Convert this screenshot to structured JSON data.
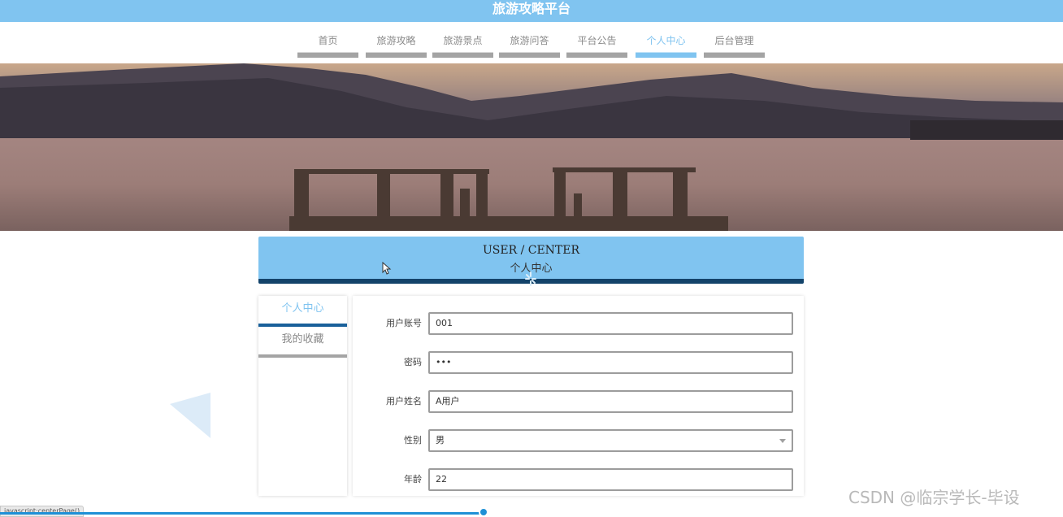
{
  "header": {
    "title": "旅游攻略平台"
  },
  "nav": {
    "items": [
      {
        "label": "首页"
      },
      {
        "label": "旅游攻略"
      },
      {
        "label": "旅游景点"
      },
      {
        "label": "旅游问答"
      },
      {
        "label": "平台公告"
      },
      {
        "label": "个人中心",
        "active": true
      },
      {
        "label": "后台管理"
      }
    ]
  },
  "center": {
    "title_en": "USER / CENTER",
    "title_cn": "个人中心"
  },
  "sidebar": {
    "items": [
      {
        "label": "个人中心",
        "active": true
      },
      {
        "label": "我的收藏"
      }
    ]
  },
  "form": {
    "fields": [
      {
        "label": "用户账号",
        "value": "001"
      },
      {
        "label": "密码",
        "value": "•••"
      },
      {
        "label": "用户姓名",
        "value": "A用户"
      },
      {
        "label": "性别",
        "value": "男",
        "type": "select"
      },
      {
        "label": "年龄",
        "value": "22"
      }
    ]
  },
  "status": {
    "link": "javascript:centerPage()"
  },
  "watermark": {
    "text": "CSDN @临宗学长-毕设"
  },
  "colors": {
    "accent": "#80c4f0",
    "dark": "#13436a",
    "inactive_bar": "#a4a4a4"
  },
  "icons": [
    "cursor-icon",
    "loading-spinner-icon",
    "chevron-down-icon"
  ]
}
